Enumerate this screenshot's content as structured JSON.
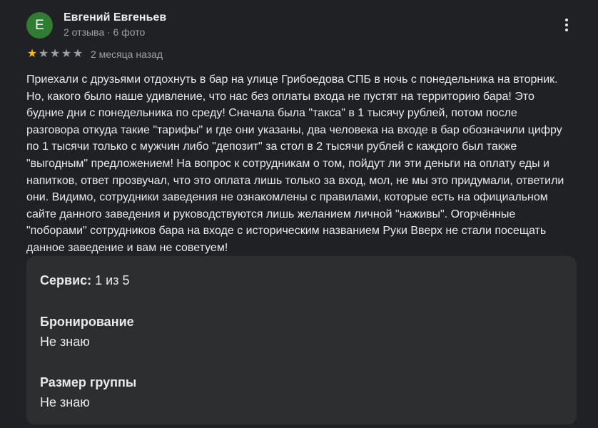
{
  "author": {
    "initial": "Е",
    "name": "Евгений Евгеньев",
    "meta": "2 отзыва · 6 фото"
  },
  "colors": {
    "avatar_bg": "#2e7d32",
    "star_filled": "#fbbc04",
    "star_empty": "#9aa0a6",
    "background": "#202124",
    "card": "#2d2e30"
  },
  "rating": {
    "stars": 1,
    "max": 5,
    "date": "2 месяца назад"
  },
  "review_text": "Приехали с друзьями отдохнуть в бар на улице Грибоедова СПБ в ночь с понедельника на вторник. Но, какого было наше удивление, что нас без оплаты входа не пустят на территорию бара! Это будние дни с понедельника по среду! Сначала была \"такса\" в 1 тысячу рублей, потом после разговора откуда такие \"тарифы\" и где они указаны, два человека на входе в бар обозначили цифру по 1 тысячи только с мужчин либо \"депозит\" за стол в 2 тысячи рублей с каждого был также \"выгодным\" предложением! На вопрос к сотрудникам о том, пойдут ли эти деньги на оплату еды и напитков, ответ прозвучал, что это оплата лишь только за вход, мол, не мы это придумали, ответили они. Видимо, сотрудники заведения не ознакомлены с правилами, которые есть на официальном сайте данного заведения и руководствуются лишь желанием личной \"наживы\". Огорчённые \"поборами\" сотрудников бара на входе с историческим названием Руки Вверх не стали посещать данное заведение и вам не советуем!",
  "attributes": {
    "service_label": "Сервис:",
    "service_value": "1 из 5",
    "booking_label": "Бронирование",
    "booking_value": "Не знаю",
    "group_label": "Размер группы",
    "group_value": "Не знаю"
  },
  "icons": {
    "menu": "more-vert-icon",
    "star": "star-icon"
  }
}
